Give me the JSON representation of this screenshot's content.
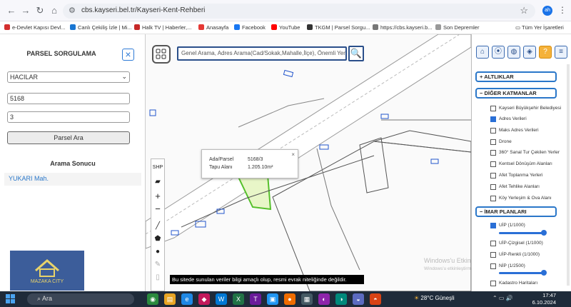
{
  "browser": {
    "url": "cbs.kayseri.bel.tr/Kayseri-Kent-Rehberi",
    "avatar": "ah",
    "bookmarks": [
      {
        "label": "e-Devlet Kapısı Devl...",
        "color": "#d32f2f"
      },
      {
        "label": "Canlı Çekiliş İzle | Mi...",
        "color": "#1976d2"
      },
      {
        "label": "Halk TV | Haberler,...",
        "color": "#c62828"
      },
      {
        "label": "Anasayfa",
        "color": "#e53935"
      },
      {
        "label": "Facebook",
        "color": "#1877f2"
      },
      {
        "label": "YouTube",
        "color": "#ff0000"
      },
      {
        "label": "TKGM | Parsel Sorgu...",
        "color": "#333333"
      },
      {
        "label": "https://cbs.kayseri.b...",
        "color": "#777777"
      },
      {
        "label": "Son Depremler",
        "color": "#999999"
      }
    ],
    "all_bookmarks": "Tüm Yer İşaretleri"
  },
  "left_panel": {
    "title": "PARSEL SORGULAMA",
    "district_selected": "HACILAR",
    "ada_value": "5168",
    "parsel_value": "3",
    "search_button": "Parsel Ara",
    "result_title": "Arama Sonucu",
    "result_item": "YUKARI Mah.",
    "logo_text": "MAZAKA CITY"
  },
  "map": {
    "search_placeholder": "Genel Arama, Adres Arama(Cad/Sokak,Mahalle,İlçe), Önemli Yer Arama",
    "shp_label": "SHP",
    "popup": {
      "ada_label": "Ada/Parsel",
      "ada_value": "5168/3",
      "area_label": "Tapu Alanı",
      "area_value": "1.205.10m²"
    },
    "notice": "Bu sitede sunulan veriler bilgi amaçlı olup, resmi evrak niteliğinde değildir.",
    "watermark_1": "Windows'u Etkinleştir",
    "watermark_2": "Windows'u etkinleştirmek için Ayarlar'a gidin."
  },
  "right_panel": {
    "sections": {
      "altliklar": "ALTLIKLAR",
      "diger": "DİĞER KATMANLAR",
      "imar": "İMAR PLANLARI"
    },
    "layers": [
      {
        "label": "Kayseri Büyükşehir Belediyesi",
        "checked": false
      },
      {
        "label": "Adres Verileri",
        "checked": true
      },
      {
        "label": "Maks Adres Verileri",
        "checked": false
      },
      {
        "label": "Drone",
        "checked": false
      },
      {
        "label": "360° Sanal Tur Çekilen Yerler",
        "checked": false
      },
      {
        "label": "Kentsel Dönüşüm Alanları",
        "checked": false
      },
      {
        "label": "Afet Toplanma Yerleri",
        "checked": false
      },
      {
        "label": "Afet Tehlike Alanları",
        "checked": false
      },
      {
        "label": "Köy Yerleşim & Ova Alanı",
        "checked": false
      }
    ],
    "imar": [
      {
        "label": "UİP (1/1000)",
        "checked": true
      },
      {
        "label": "UİP-Çizgisel (1/1000)",
        "checked": false
      },
      {
        "label": "UİP-Renkli (1/1000)",
        "checked": false
      },
      {
        "label": "NİP (1/2500)",
        "checked": false
      },
      {
        "label": "Kadastro Haritaları",
        "checked": false
      }
    ]
  },
  "taskbar": {
    "search": "Ara",
    "weather": "28°C  Güneşli",
    "time": "17:47",
    "date": "6.10.2024"
  }
}
